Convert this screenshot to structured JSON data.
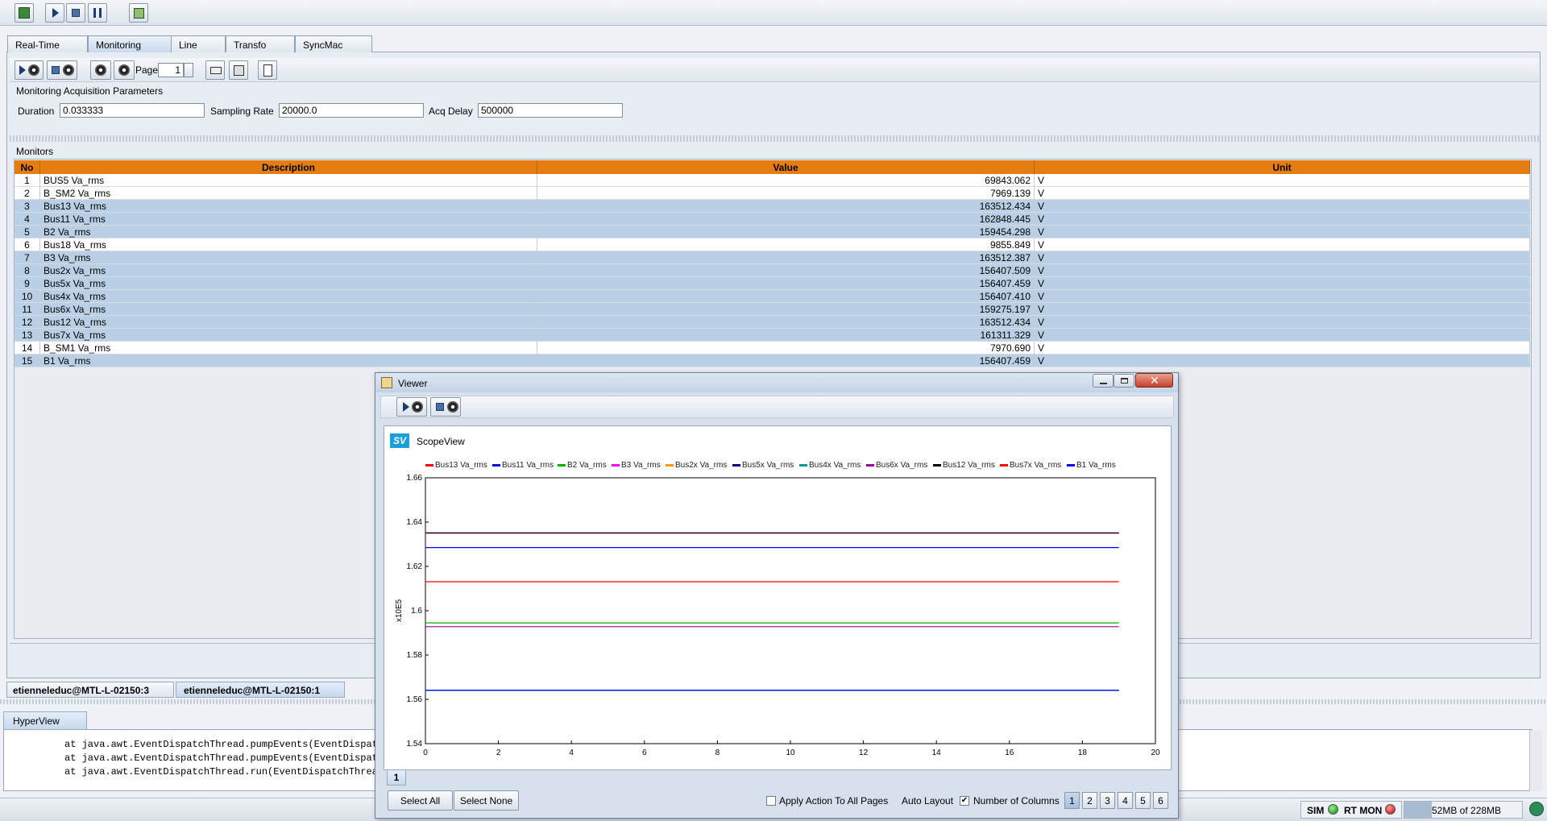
{
  "tabs": [
    "Real-Time",
    "Monitoring",
    "Line",
    "Transfo",
    "SyncMac"
  ],
  "active_tab": "Monitoring",
  "toolbar": {
    "page_label": "Page",
    "page_value": "1"
  },
  "params": {
    "title": "Monitoring Acquisition Parameters",
    "duration_label": "Duration",
    "duration_value": "0.033333",
    "sampling_label": "Sampling Rate",
    "sampling_value": "20000.0",
    "acqdelay_label": "Acq Delay",
    "acqdelay_value": "500000"
  },
  "monitors": {
    "title": "Monitors",
    "columns": [
      "No",
      "Description",
      "Value",
      "Unit"
    ],
    "rows": [
      {
        "no": "1",
        "desc": "BUS5 Va_rms",
        "value": "69843.062",
        "unit": "V",
        "selected": false
      },
      {
        "no": "2",
        "desc": "B_SM2 Va_rms",
        "value": "7969.139",
        "unit": "V",
        "selected": false
      },
      {
        "no": "3",
        "desc": "Bus13 Va_rms",
        "value": "163512.434",
        "unit": "V",
        "selected": true
      },
      {
        "no": "4",
        "desc": "Bus11 Va_rms",
        "value": "162848.445",
        "unit": "V",
        "selected": true
      },
      {
        "no": "5",
        "desc": "B2 Va_rms",
        "value": "159454.298",
        "unit": "V",
        "selected": true
      },
      {
        "no": "6",
        "desc": "Bus18 Va_rms",
        "value": "9855.849",
        "unit": "V",
        "selected": false
      },
      {
        "no": "7",
        "desc": "B3 Va_rms",
        "value": "163512.387",
        "unit": "V",
        "selected": true
      },
      {
        "no": "8",
        "desc": "Bus2x Va_rms",
        "value": "156407.509",
        "unit": "V",
        "selected": true
      },
      {
        "no": "9",
        "desc": "Bus5x Va_rms",
        "value": "156407.459",
        "unit": "V",
        "selected": true
      },
      {
        "no": "10",
        "desc": "Bus4x Va_rms",
        "value": "156407.410",
        "unit": "V",
        "selected": true
      },
      {
        "no": "11",
        "desc": "Bus6x Va_rms",
        "value": "159275.197",
        "unit": "V",
        "selected": true
      },
      {
        "no": "12",
        "desc": "Bus12 Va_rms",
        "value": "163512.434",
        "unit": "V",
        "selected": true
      },
      {
        "no": "13",
        "desc": "Bus7x Va_rms",
        "value": "161311.329",
        "unit": "V",
        "selected": true
      },
      {
        "no": "14",
        "desc": "B_SM1 Va_rms",
        "value": "7970.690",
        "unit": "V",
        "selected": false
      },
      {
        "no": "15",
        "desc": "B1 Va_rms",
        "value": "156407.459",
        "unit": "V",
        "selected": true
      }
    ]
  },
  "sessions": [
    "etienneleduc@MTL-L-02150:3",
    "etienneleduc@MTL-L-02150:1"
  ],
  "hyperview": {
    "tab": "HyperView",
    "lines": [
      "at java.awt.EventDispatchThread.pumpEvents(EventDispatc",
      "at java.awt.EventDispatchThread.pumpEvents(EventDispatc",
      "at java.awt.EventDispatchThread.run(EventDispatchThread"
    ]
  },
  "viewer": {
    "title": "Viewer",
    "scope_badge": "SV",
    "scope_title": "ScopeView",
    "page_tab": "1",
    "select_all": "Select All",
    "select_none": "Select None",
    "apply_all": "Apply Action To All Pages",
    "auto_layout": "Auto Layout",
    "num_columns": "Number of Columns",
    "column_options": [
      "1",
      "2",
      "3",
      "4",
      "5",
      "6"
    ]
  },
  "status": {
    "sim": "SIM",
    "rtmon": "RT MON",
    "memory": "52MB of 228MB"
  },
  "chart_data": {
    "type": "line",
    "ylabel": "x10E5",
    "xlim": [
      0,
      20
    ],
    "ylim": [
      1.54,
      1.66
    ],
    "xticks": [
      "0",
      "2",
      "4",
      "6",
      "8",
      "10",
      "12",
      "14",
      "16",
      "18",
      "20"
    ],
    "yticks": [
      "1.54",
      "1.56",
      "1.58",
      "1.6",
      "1.62",
      "1.64",
      "1.66"
    ],
    "x": [
      0,
      19
    ],
    "series": [
      {
        "name": "Bus13 Va_rms",
        "color": "#ff0000",
        "values": [
          1.6351,
          1.6351
        ]
      },
      {
        "name": "Bus11 Va_rms",
        "color": "#0000ff",
        "values": [
          1.6285,
          1.6285
        ]
      },
      {
        "name": "B2 Va_rms",
        "color": "#00b000",
        "values": [
          1.5945,
          1.5945
        ]
      },
      {
        "name": "B3 Va_rms",
        "color": "#ff00ff",
        "values": [
          1.6351,
          1.6351
        ]
      },
      {
        "name": "Bus2x Va_rms",
        "color": "#ff9900",
        "values": [
          1.5641,
          1.5641
        ]
      },
      {
        "name": "Bus5x Va_rms",
        "color": "#000080",
        "values": [
          1.5641,
          1.5641
        ]
      },
      {
        "name": "Bus4x Va_rms",
        "color": "#009999",
        "values": [
          1.5641,
          1.5641
        ]
      },
      {
        "name": "Bus6x Va_rms",
        "color": "#990099",
        "values": [
          1.5928,
          1.5928
        ]
      },
      {
        "name": "Bus12 Va_rms",
        "color": "#000000",
        "values": [
          1.6351,
          1.6351
        ]
      },
      {
        "name": "Bus7x Va_rms",
        "color": "#ff0000",
        "values": [
          1.6131,
          1.6131
        ]
      },
      {
        "name": "B1 Va_rms",
        "color": "#0000ff",
        "values": [
          1.5641,
          1.5641
        ]
      }
    ]
  }
}
